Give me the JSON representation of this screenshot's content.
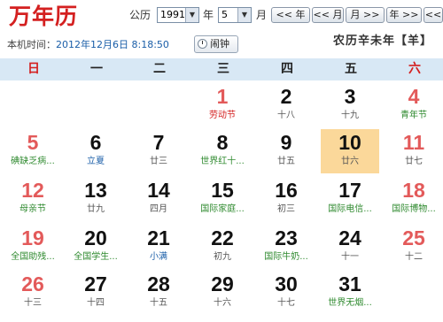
{
  "app": {
    "title": "万年历",
    "time_label": "本机时间：",
    "time_value": "2012年12月6日 8:18:50",
    "alarm_label": "闹钟",
    "lunar_info": "农历辛未年【羊】"
  },
  "controls": {
    "calendar_type": "公历",
    "year_value": "1991",
    "year_unit": "年",
    "month_value": "5",
    "month_unit": "月",
    "prev_year": "<< 年",
    "next_year": "年 >>",
    "prev_month": "<< 月",
    "next_month": "月 >>",
    "prev_year2": "年 >>",
    "today": "<<"
  },
  "weekdays": [
    {
      "label": "日",
      "weekend": true
    },
    {
      "label": "一",
      "weekend": false
    },
    {
      "label": "二",
      "weekend": false
    },
    {
      "label": "三",
      "weekend": false
    },
    {
      "label": "四",
      "weekend": false
    },
    {
      "label": "五",
      "weekend": false
    },
    {
      "label": "六",
      "weekend": true
    }
  ],
  "calendar": {
    "selected_day": "10",
    "rows": [
      [
        null,
        null,
        null,
        {
          "day": "1",
          "sub": "劳动节",
          "sub_color": "red",
          "red": true
        },
        {
          "day": "2",
          "sub": "十八",
          "sub_color": "gray",
          "red": false
        },
        {
          "day": "3",
          "sub": "十九",
          "sub_color": "gray",
          "red": false
        },
        {
          "day": "4",
          "sub": "青年节",
          "sub_color": "green",
          "red": true
        }
      ],
      [
        {
          "day": "5",
          "sub": "碘缺乏病...",
          "sub_color": "green",
          "red": true
        },
        {
          "day": "6",
          "sub": "立夏",
          "sub_color": "blue",
          "red": false
        },
        {
          "day": "7",
          "sub": "廿三",
          "sub_color": "gray",
          "red": false
        },
        {
          "day": "8",
          "sub": "世界红十...",
          "sub_color": "green",
          "red": false
        },
        {
          "day": "9",
          "sub": "廿五",
          "sub_color": "gray",
          "red": false
        },
        {
          "day": "10",
          "sub": "廿六",
          "sub_color": "gray",
          "red": false
        },
        {
          "day": "11",
          "sub": "廿七",
          "sub_color": "gray",
          "red": true
        }
      ],
      [
        {
          "day": "12",
          "sub": "母亲节",
          "sub_color": "green",
          "red": true
        },
        {
          "day": "13",
          "sub": "廿九",
          "sub_color": "gray",
          "red": false
        },
        {
          "day": "14",
          "sub": "四月",
          "sub_color": "gray",
          "red": false
        },
        {
          "day": "15",
          "sub": "国际家庭...",
          "sub_color": "green",
          "red": false
        },
        {
          "day": "16",
          "sub": "初三",
          "sub_color": "gray",
          "red": false
        },
        {
          "day": "17",
          "sub": "国际电信...",
          "sub_color": "green",
          "red": false
        },
        {
          "day": "18",
          "sub": "国际博物...",
          "sub_color": "green",
          "red": true
        }
      ],
      [
        {
          "day": "19",
          "sub": "全国助残...",
          "sub_color": "green",
          "red": true
        },
        {
          "day": "20",
          "sub": "全国学生...",
          "sub_color": "green",
          "red": false
        },
        {
          "day": "21",
          "sub": "小满",
          "sub_color": "blue",
          "red": false
        },
        {
          "day": "22",
          "sub": "初九",
          "sub_color": "gray",
          "red": false
        },
        {
          "day": "23",
          "sub": "国际牛奶...",
          "sub_color": "green",
          "red": false
        },
        {
          "day": "24",
          "sub": "十一",
          "sub_color": "gray",
          "red": false
        },
        {
          "day": "25",
          "sub": "十二",
          "sub_color": "gray",
          "red": true
        }
      ],
      [
        {
          "day": "26",
          "sub": "十三",
          "sub_color": "gray",
          "red": true
        },
        {
          "day": "27",
          "sub": "十四",
          "sub_color": "gray",
          "red": false
        },
        {
          "day": "28",
          "sub": "十五",
          "sub_color": "gray",
          "red": false
        },
        {
          "day": "29",
          "sub": "十六",
          "sub_color": "gray",
          "red": false
        },
        {
          "day": "30",
          "sub": "十七",
          "sub_color": "gray",
          "red": false
        },
        {
          "day": "31",
          "sub": "世界无烟...",
          "sub_color": "green",
          "red": false
        },
        null
      ]
    ]
  }
}
